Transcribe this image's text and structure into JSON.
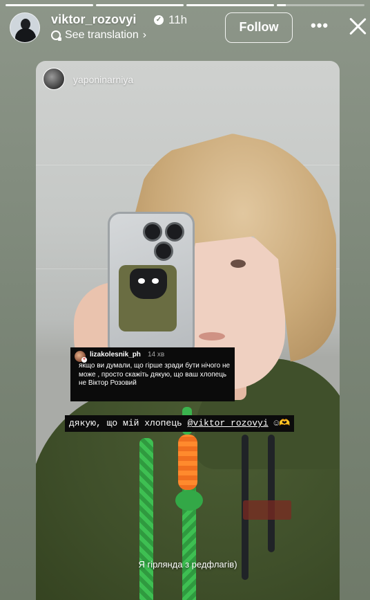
{
  "story": {
    "progress": [
      1,
      1,
      1,
      0.1
    ],
    "header": {
      "username": "viktor_rozovyi",
      "time_ago": "11h",
      "see_translation": "See translation",
      "follow_label": "Follow",
      "more_label": "•••"
    },
    "repost": {
      "original_author": "yaponinarniya",
      "comment": {
        "username": "lizakolesnik_ph",
        "time": "14 хв",
        "text": "якщо ви думали, що гірше зради бути нічого не може , просто скажіть дякую, що ваш хлопець не Віктор Розовий"
      },
      "caption_top_prefix": "дякую, що мій хлопець ",
      "caption_top_mention": "@viktor_rozovyi",
      "caption_top_emoji": " ☺🫶",
      "caption_bottom": "Я гірлянда з редфлагів)"
    }
  },
  "colors": {
    "background": "#7a8576",
    "hoodie": "#3f4f2a",
    "lanyard": "#2f9a3f",
    "carrot": "#f06f1f"
  },
  "icons": {
    "verified": "verified-badge-icon",
    "translate": "translate-icon",
    "chevron": "chevron-right-icon",
    "more": "more-options-icon",
    "close": "close-icon"
  }
}
